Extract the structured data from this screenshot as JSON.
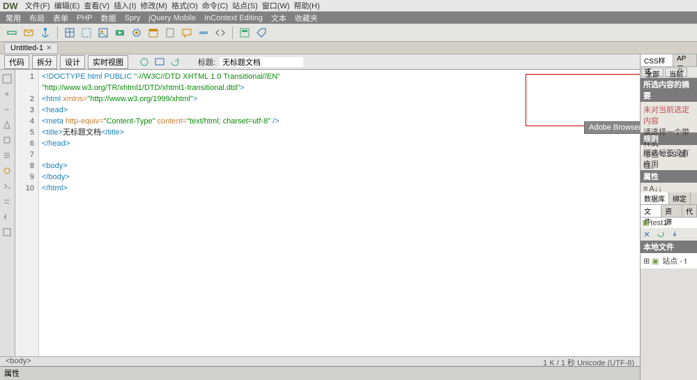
{
  "app": {
    "logo": "DW"
  },
  "menu": [
    "文件(F)",
    "编辑(E)",
    "查看(V)",
    "插入(I)",
    "修改(M)",
    "格式(O)",
    "命令(C)",
    "站点(S)",
    "窗口(W)",
    "帮助(H)"
  ],
  "categoryTabs": [
    "常用",
    "布局",
    "表单",
    "PHP",
    "数据",
    "Spry",
    "jQuery Mobile",
    "InContext Editing",
    "文本",
    "收藏夹"
  ],
  "docTab": {
    "name": "Untitled-1"
  },
  "viewButtons": {
    "code": "代码",
    "split": "拆分",
    "design": "设计",
    "live": "实时视图"
  },
  "titleField": {
    "label": "标题:",
    "value": "无标题文档"
  },
  "code": {
    "lines": [
      1,
      2,
      3,
      4,
      5,
      6,
      7,
      8,
      9,
      10
    ],
    "l1a": "<!DOCTYPE html PUBLIC ",
    "l1b": "\"-//W3C//DTD XHTML 1.0 Transitional//EN\"",
    "l1c": "\"http://www.w3.org/TR/xhtml1/DTD/xhtml1-transitional.dtd\"",
    "l1d": ">",
    "l2a": "<html ",
    "l2b": "xmlns=",
    "l2c": "\"http://www.w3.org/1999/xhtml\"",
    "l2d": ">",
    "l3": "<head>",
    "l4a": "<meta ",
    "l4b": "http-equiv=",
    "l4c": "\"Content-Type\"",
    "l4d": " content=",
    "l4e": "\"text/html; charset=utf-8\"",
    "l4f": " />",
    "l5a": "<title>",
    "l5b": "无标题文档",
    "l5c": "</title>",
    "l6": "</head>",
    "l7": "",
    "l8": "<body>",
    "l9": "</body>",
    "l10": "</html>"
  },
  "browserLab": {
    "title": "Adobe BrowserLab"
  },
  "rightPanels": {
    "cssTabs": {
      "css": "CSS样式",
      "ap": "AP 元"
    },
    "miniAll": "全部",
    "miniCurrent": "当前",
    "summaryHead": "所选内容的摘要",
    "summaryBody1": "未对当前选定内容",
    "summaryBody2": "请选择一个带样式",
    "summaryBody3": "哪些 CSS 属性。",
    "rulesHead": "规则",
    "rulesBody": "所选标签没有应用",
    "propsHead": "属性",
    "dbTabs": {
      "db": "数据库",
      "bind": "绑定"
    },
    "fileTabs": {
      "files": "文件",
      "assets": "资源",
      "code": "代"
    },
    "site": "test1",
    "localHead": "本地文件",
    "siteRow": "站点 - t"
  },
  "status": {
    "tag": "<body>",
    "info": "1 K / 1 秒 Unicode (UTF-8)"
  },
  "propPanel": {
    "label": "属性"
  }
}
